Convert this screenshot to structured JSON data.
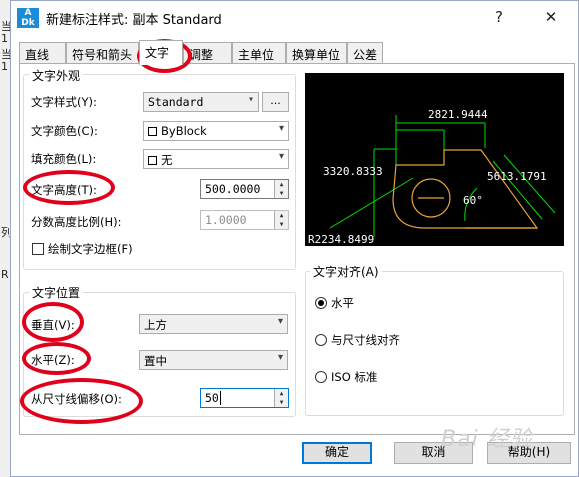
{
  "background_window": {
    "chars": [
      "当",
      "1",
      "当",
      "1",
      "列",
      "R"
    ]
  },
  "dialog": {
    "title": "新建标注样式: 副本 Standard",
    "help_glyph": "?",
    "close_glyph": "✕"
  },
  "tabs": [
    "直线",
    "符号和箭头",
    "文字",
    "调整",
    "主单位",
    "换算单位",
    "公差"
  ],
  "active_tab": "文字",
  "text_appearance": {
    "title": "文字外观",
    "style_label": "文字样式(Y):",
    "style_value": "Standard",
    "ellipsis": "...",
    "color_label": "文字颜色(C):",
    "color_value": "ByBlock",
    "fill_label": "填充颜色(L):",
    "fill_value": "无",
    "height_label": "文字高度(T):",
    "height_value": "500.0000",
    "fraction_label": "分数高度比例(H):",
    "fraction_value": "1.0000",
    "frame_label": "绘制文字边框(F)",
    "frame_checked": false
  },
  "preview": {
    "dim_top": "2821.9444",
    "dim_left": "3320.8333",
    "dim_right": "5613.1791",
    "angle": "60°",
    "radius": "R2234.8499"
  },
  "text_placement": {
    "title": "文字位置",
    "vertical_label": "垂直(V):",
    "vertical_value": "上方",
    "horizontal_label": "水平(Z):",
    "horizontal_value": "置中",
    "offset_label": "从尺寸线偏移(O):",
    "offset_value": "50"
  },
  "text_alignment": {
    "title": "文字对齐(A)",
    "options": [
      "水平",
      "与尺寸线对齐",
      "ISO 标准"
    ],
    "selected_index": 0
  },
  "buttons": {
    "ok": "确定",
    "cancel": "取消",
    "help": "帮助(H)"
  },
  "watermark": "Bai 经验",
  "colors": {
    "highlight_oval": "#e0001b",
    "preview_dim": "#00e000",
    "preview_shape": "#e6a33a",
    "preview_text": "#ffffff"
  }
}
